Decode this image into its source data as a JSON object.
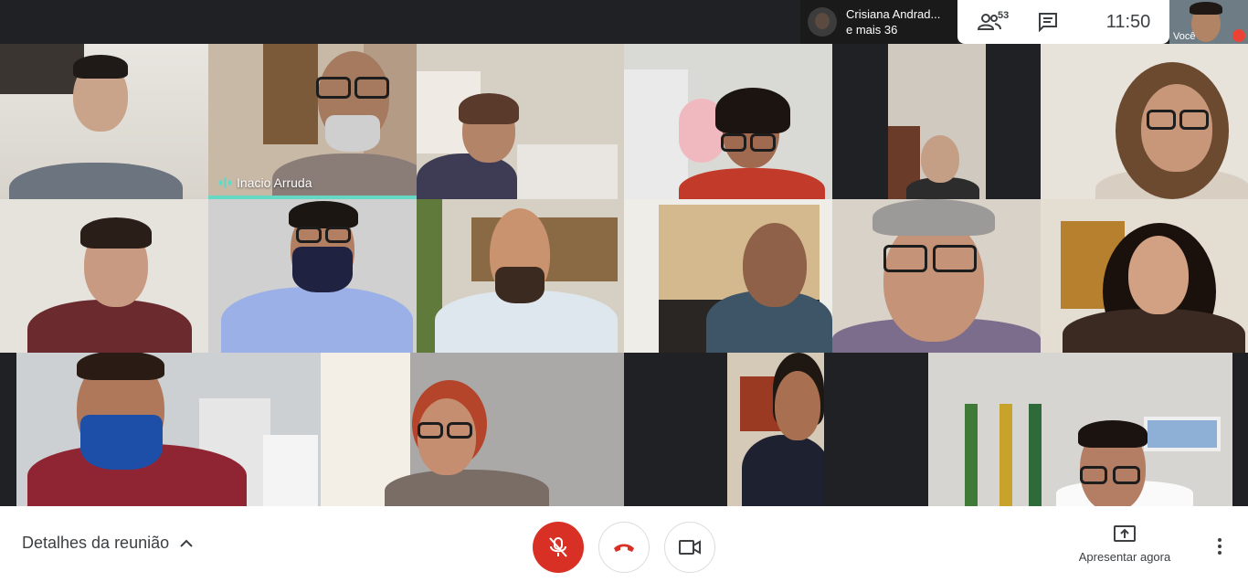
{
  "participants": [
    {
      "id": "p1",
      "name": ""
    },
    {
      "id": "p2",
      "name": "Inacio Arruda",
      "speaking": true
    },
    {
      "id": "p3",
      "name": ""
    },
    {
      "id": "p4",
      "name": ""
    },
    {
      "id": "p5",
      "name": ""
    },
    {
      "id": "p6",
      "name": ""
    },
    {
      "id": "p7",
      "name": ""
    },
    {
      "id": "p8",
      "name": ""
    },
    {
      "id": "p9",
      "name": ""
    },
    {
      "id": "p10",
      "name": ""
    },
    {
      "id": "p11",
      "name": ""
    },
    {
      "id": "p12",
      "name": ""
    },
    {
      "id": "p13",
      "name": ""
    },
    {
      "id": "p14",
      "name": ""
    },
    {
      "id": "p15",
      "name": ""
    },
    {
      "id": "p16",
      "name": ""
    }
  ],
  "top_bar": {
    "presenter_name": "Crisiana Andrad...",
    "others_label": "e mais 36",
    "participant_count": "53",
    "time": "11:50",
    "self_label": "Você",
    "icons": [
      "people-icon",
      "chat-icon"
    ]
  },
  "bottom_bar": {
    "meeting_details_label": "Detalhes da reunião",
    "present_label": "Apresentar agora",
    "mic_state": "muted",
    "colors": {
      "mic_muted": "#d93025",
      "hangup": "#d93025",
      "speaking": "#66d9c4"
    }
  }
}
